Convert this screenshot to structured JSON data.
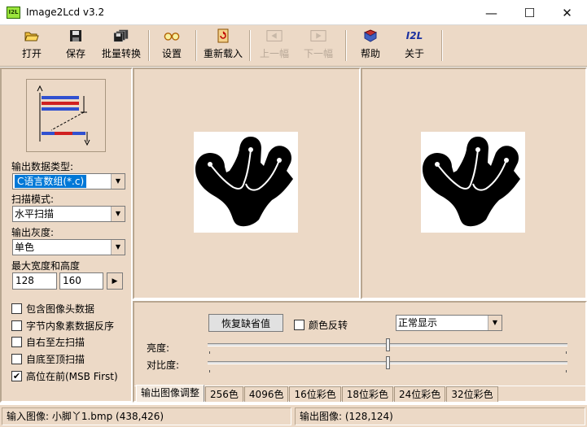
{
  "window": {
    "title": "Image2Lcd v3.2",
    "icon_text": "I2L",
    "minimize_glyph": "—",
    "maximize_glyph": "☐",
    "close_glyph": "✕"
  },
  "toolbar": {
    "open": "打开",
    "save": "保存",
    "batch": "批量转换",
    "settings": "设置",
    "reload": "重新载入",
    "prev": "上一幅",
    "next": "下一幅",
    "help": "帮助",
    "about": "关于",
    "about_icon_text": "I2L"
  },
  "left": {
    "output_type_label": "输出数据类型:",
    "output_type_value": "C语言数组(*.c)",
    "scan_mode_label": "扫描模式:",
    "scan_mode_value": "水平扫描",
    "gray_label": "输出灰度:",
    "gray_value": "单色",
    "maxsize_label": "最大宽度和高度",
    "width_value": "128",
    "height_value": "160",
    "checkboxes": [
      {
        "label": "包含图像头数据",
        "checked": false
      },
      {
        "label": "字节内象素数据反序",
        "checked": false
      },
      {
        "label": "自右至左扫描",
        "checked": false
      },
      {
        "label": "自底至顶扫描",
        "checked": false
      },
      {
        "label": "高位在前(MSB First)",
        "checked": true
      }
    ],
    "check_mark": "✔"
  },
  "controls": {
    "restore_button": "恢复缺省值",
    "invert_label": "颜色反转",
    "display_mode": "正常显示",
    "brightness_label": "亮度:",
    "contrast_label": "对比度:",
    "brightness_level": 0.5,
    "contrast_level": 0.5
  },
  "tabs": [
    "输出图像调整",
    "256色",
    "4096色",
    "16位彩色",
    "18位彩色",
    "24位彩色",
    "32位彩色"
  ],
  "status": {
    "input": "输入图像: 小脚丫1.bmp (438,426)",
    "output": "输出图像: (128,124)"
  },
  "colors": {
    "panel": "#ecd9c6",
    "selection": "#0078d7"
  }
}
